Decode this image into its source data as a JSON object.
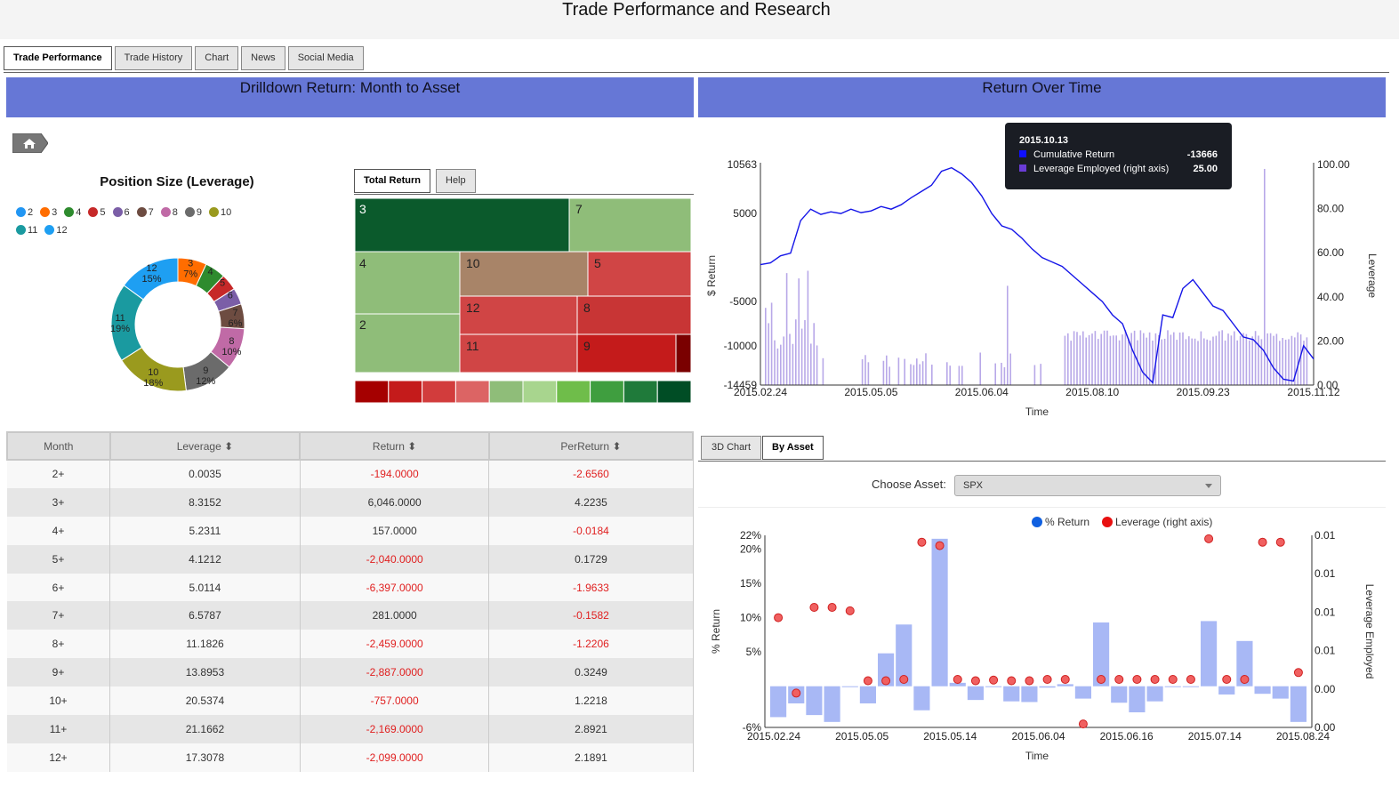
{
  "app": {
    "title": "Trade Performance and Research"
  },
  "tabs": [
    {
      "label": "Trade Performance",
      "active": true
    },
    {
      "label": "Trade History"
    },
    {
      "label": "Chart"
    },
    {
      "label": "News"
    },
    {
      "label": "Social Media"
    }
  ],
  "left_panel": {
    "title": "Drilldown Return: Month to Asset"
  },
  "right_panel": {
    "title": "Return Over Time"
  },
  "pie": {
    "title": "Position Size (Leverage)",
    "legend": [
      {
        "label": "2",
        "color": "#2196f3"
      },
      {
        "label": "3",
        "color": "#ff6d00"
      },
      {
        "label": "4",
        "color": "#2e8b2e"
      },
      {
        "label": "5",
        "color": "#c62828"
      },
      {
        "label": "6",
        "color": "#7b5ea7"
      },
      {
        "label": "7",
        "color": "#6d4c41"
      },
      {
        "label": "8",
        "color": "#c06aa6"
      },
      {
        "label": "9",
        "color": "#6b6b6b"
      },
      {
        "label": "10",
        "color": "#9a9a1e"
      },
      {
        "label": "11",
        "color": "#1a9aa0"
      },
      {
        "label": "12",
        "color": "#1e9ff2"
      }
    ]
  },
  "treemap": {
    "tabs": [
      {
        "label": "Total Return",
        "active": true
      },
      {
        "label": "Help"
      }
    ],
    "cells": [
      "3",
      "7",
      "4",
      "10",
      "5",
      "12",
      "8",
      "2",
      "11",
      "9"
    ],
    "scale_colors": [
      "#a50000",
      "#c41b1b",
      "#d23c3c",
      "#dc6464",
      "#8fbd79",
      "#a8d58e",
      "#6fbd4a",
      "#3f9e3f",
      "#1f7a3a",
      "#004d25"
    ]
  },
  "table": {
    "columns": [
      "Month",
      "Leverage",
      "Return",
      "PerReturn"
    ],
    "rows": [
      [
        "2+",
        "0.0035",
        "-194.0000",
        "-2.6560"
      ],
      [
        "3+",
        "8.3152",
        "6,046.0000",
        "4.2235"
      ],
      [
        "4+",
        "5.2311",
        "157.0000",
        "-0.0184"
      ],
      [
        "5+",
        "4.1212",
        "-2,040.0000",
        "0.1729"
      ],
      [
        "6+",
        "5.0114",
        "-6,397.0000",
        "-1.9633"
      ],
      [
        "7+",
        "6.5787",
        "281.0000",
        "-0.1582"
      ],
      [
        "8+",
        "11.1826",
        "-2,459.0000",
        "-1.2206"
      ],
      [
        "9+",
        "13.8953",
        "-2,887.0000",
        "0.3249"
      ],
      [
        "10+",
        "20.5374",
        "-757.0000",
        "1.2218"
      ],
      [
        "11+",
        "21.1662",
        "-2,169.0000",
        "2.8921"
      ],
      [
        "12+",
        "17.3078",
        "-2,099.0000",
        "2.1891"
      ]
    ]
  },
  "tooltip": {
    "date": "2015.10.13",
    "rows": [
      {
        "label": "Cumulative Return",
        "value": "-13666",
        "color": "#1010ff"
      },
      {
        "label": "Leverage Employed (right axis)",
        "value": "25.00",
        "color": "#6a3cd6"
      }
    ]
  },
  "bottom": {
    "tabs": [
      {
        "label": "3D Chart"
      },
      {
        "label": "By Asset",
        "active": true
      }
    ],
    "choose_label": "Choose Asset:",
    "asset": "SPX",
    "legend": [
      {
        "label": "% Return",
        "color": "#1060e0"
      },
      {
        "label": "Leverage (right axis)",
        "color": "#e81010"
      }
    ]
  },
  "chart_data": [
    {
      "type": "pie",
      "title": "Position Size (Leverage)",
      "slices": [
        {
          "label": "3",
          "pct": 7,
          "text": "7%",
          "color": "#ff6d00"
        },
        {
          "label": "4",
          "pct": 5,
          "color": "#2e8b2e"
        },
        {
          "label": "5",
          "pct": 4,
          "color": "#c62828"
        },
        {
          "label": "6",
          "pct": 4,
          "color": "#7b5ea7"
        },
        {
          "label": "7",
          "pct": 6,
          "text": "6%",
          "color": "#6d4c41"
        },
        {
          "label": "8",
          "pct": 10,
          "text": "10%",
          "color": "#c06aa6"
        },
        {
          "label": "9",
          "pct": 12,
          "text": "12%",
          "color": "#6b6b6b"
        },
        {
          "label": "10",
          "pct": 18,
          "text": "18%",
          "color": "#9a9a1e"
        },
        {
          "label": "11",
          "pct": 19,
          "text": "19%",
          "color": "#1a9aa0"
        },
        {
          "label": "12",
          "pct": 15,
          "text": "15%",
          "color": "#1e9ff2"
        }
      ]
    },
    {
      "type": "line",
      "xlabel": "Time",
      "ylabel": "$ Return",
      "y2label": "Leverage",
      "x_ticks": [
        "2015.02.24",
        "2015.05.05",
        "2015.06.04",
        "2015.08.10",
        "2015.09.23",
        "2015.11.12"
      ],
      "y_ticks": [
        "10563",
        "5000",
        "-5000",
        "-10000",
        "-14459"
      ],
      "y_tick_values": [
        10563,
        5000,
        -5000,
        -10000,
        -14459
      ],
      "ylim": [
        -14459,
        10563
      ],
      "y2_ticks": [
        "100.00",
        "80.00",
        "60.00",
        "40.00",
        "20.00",
        "0.00"
      ],
      "y2lim": [
        0,
        100
      ],
      "series": [
        {
          "values": [
            -800,
            -600,
            200,
            500,
            4200,
            5500,
            4900,
            5200,
            5000,
            5500,
            5100,
            5300,
            5800,
            5500,
            6000,
            6800,
            7500,
            8200,
            9800,
            10200,
            9500,
            8500,
            7000,
            5000,
            3600,
            3200,
            2200,
            1000,
            0,
            -500,
            -1000,
            -2000,
            -3000,
            -4000,
            -5000,
            -6500,
            -7500,
            -10500,
            -13000,
            -14200,
            -6500,
            -6800,
            -3500,
            -2500,
            -4000,
            -5500,
            -6000,
            -7500,
            -9000,
            -9300,
            -10500,
            -12500,
            -13800,
            -14000,
            -10000,
            -11500
          ]
        }
      ]
    },
    {
      "type": "bar",
      "xlabel": "Time",
      "ylabel": "% Return",
      "y2label": "Leverage Employed",
      "x_ticks": [
        "2015.02.24",
        "2015.05.05",
        "2015.05.14",
        "2015.06.04",
        "2015.06.16",
        "2015.07.14",
        "2015.08.24"
      ],
      "y_ticks": [
        "22%",
        "20%",
        "15%",
        "10%",
        "5%",
        "-6%"
      ],
      "y_tick_values": [
        22,
        20,
        15,
        10,
        5,
        -6
      ],
      "ylim": [
        -6,
        22
      ],
      "y2_ticks": [
        "0.01",
        "0.01",
        "0.01",
        "0.01",
        "0.00",
        "0.00"
      ],
      "series": [
        {
          "name": "% Return",
          "values": [
            -4.5,
            -2.5,
            -4.2,
            -5.2,
            0,
            -2.5,
            4.8,
            9,
            -3.5,
            21.5,
            0.5,
            -2,
            0,
            -2.2,
            -2.3,
            -0.2,
            0.3,
            -1.8,
            9.3,
            -2.4,
            -3.8,
            -2.2,
            -0.1,
            -0.1,
            9.5,
            -1.2,
            6.6,
            -1.1,
            -1.8,
            -5.2
          ]
        },
        {
          "name": "Leverage (right axis)",
          "points": [
            [
              0,
              10
            ],
            [
              1,
              -1
            ],
            [
              2,
              11.5
            ],
            [
              3,
              11.5
            ],
            [
              4,
              11
            ],
            [
              5,
              0.8
            ],
            [
              6,
              0.8
            ],
            [
              7,
              1
            ],
            [
              8,
              21
            ],
            [
              9,
              20.5
            ],
            [
              10,
              1
            ],
            [
              11,
              0.8
            ],
            [
              12,
              0.9
            ],
            [
              13,
              0.8
            ],
            [
              14,
              0.8
            ],
            [
              15,
              1
            ],
            [
              16,
              1
            ],
            [
              17,
              -5.5
            ],
            [
              18,
              1
            ],
            [
              19,
              1
            ],
            [
              20,
              1
            ],
            [
              21,
              1
            ],
            [
              22,
              1
            ],
            [
              23,
              1
            ],
            [
              24,
              21.5
            ],
            [
              25,
              1
            ],
            [
              26,
              1
            ],
            [
              27,
              21
            ],
            [
              28,
              21
            ],
            [
              29,
              2
            ]
          ]
        }
      ]
    }
  ]
}
